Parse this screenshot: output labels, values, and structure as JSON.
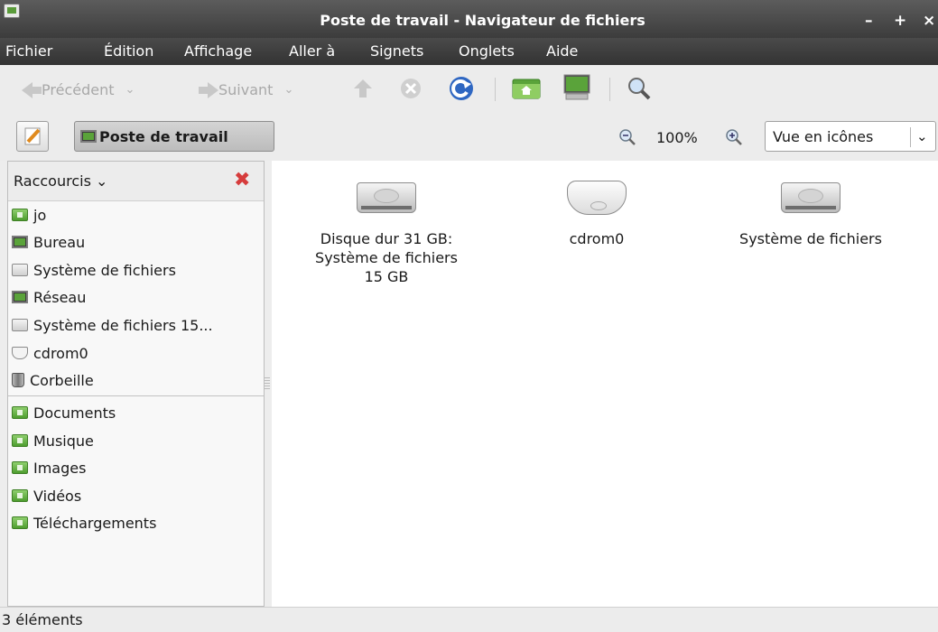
{
  "window": {
    "title": "Poste de travail - Navigateur de fichiers",
    "controls": {
      "minimize": "–",
      "maximize": "+",
      "close": "×"
    }
  },
  "menu": [
    "Fichier",
    "Édition",
    "Affichage",
    "Aller à",
    "Signets",
    "Onglets",
    "Aide"
  ],
  "toolbar": {
    "back_label": "Précédent",
    "forward_label": "Suivant",
    "icons": [
      "up-arrow-icon",
      "stop-icon",
      "reload-icon",
      "home-icon",
      "computer-icon",
      "search-icon"
    ]
  },
  "location": {
    "path_button": "Poste de travail",
    "zoom_level": "100%",
    "view_mode": "Vue en icônes"
  },
  "sidebar": {
    "header": "Raccourcis",
    "places": [
      {
        "label": "jo",
        "icon": "home-folder-icon"
      },
      {
        "label": "Bureau",
        "icon": "desktop-icon"
      },
      {
        "label": "Système de fichiers",
        "icon": "drive-icon"
      },
      {
        "label": "Réseau",
        "icon": "network-icon"
      },
      {
        "label": "Système de fichiers 15...",
        "icon": "drive-icon"
      },
      {
        "label": "cdrom0",
        "icon": "cdrom-icon"
      },
      {
        "label": "Corbeille",
        "icon": "trash-icon"
      }
    ],
    "bookmarks": [
      {
        "label": "Documents",
        "icon": "folder-icon"
      },
      {
        "label": "Musique",
        "icon": "folder-icon"
      },
      {
        "label": "Images",
        "icon": "folder-icon"
      },
      {
        "label": "Vidéos",
        "icon": "folder-icon"
      },
      {
        "label": "Téléchargements",
        "icon": "folder-icon"
      }
    ]
  },
  "files": [
    {
      "lines": [
        "Disque dur 31 GB:",
        "Système de fichiers",
        "15 GB"
      ],
      "icon": "hard-drive-icon"
    },
    {
      "lines": [
        "cdrom0"
      ],
      "icon": "optical-drive-icon"
    },
    {
      "lines": [
        "Système de fichiers"
      ],
      "icon": "hard-drive-icon"
    }
  ],
  "status": "3 éléments"
}
